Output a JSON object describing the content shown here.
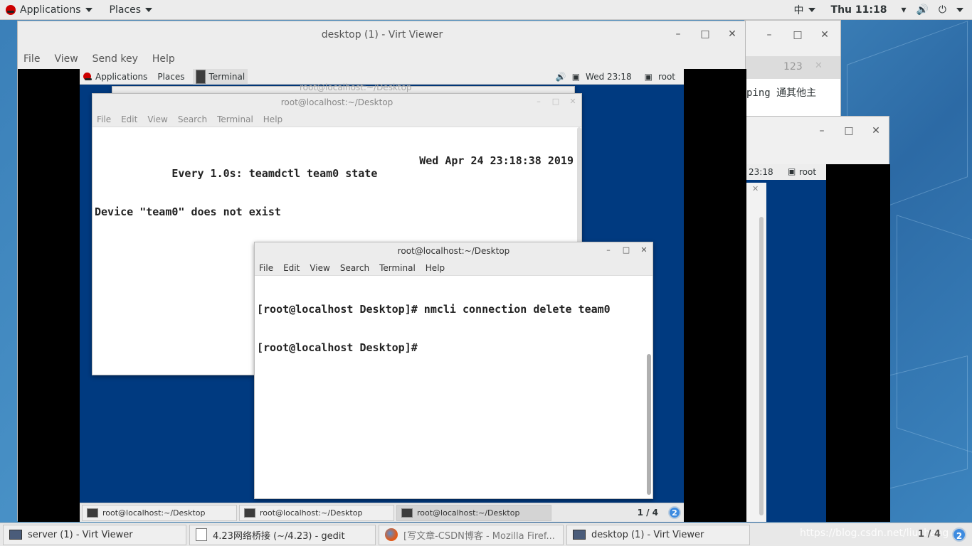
{
  "host_topbar": {
    "applications": "Applications",
    "places": "Places",
    "input_method": "中",
    "clock": "Thu 11:18"
  },
  "bg_window_1": {
    "tab_label": "123",
    "text": "ping 通其他主"
  },
  "bg_window_2": {
    "clock": "23:18",
    "user": "root"
  },
  "virt_viewer": {
    "title": "desktop (1) - Virt Viewer",
    "menu": [
      "File",
      "View",
      "Send key",
      "Help"
    ]
  },
  "guest": {
    "topbar": {
      "applications": "Applications",
      "places": "Places",
      "terminal": "Terminal",
      "clock": "Wed 23:18",
      "user": "root"
    },
    "hidden_terminal": {
      "title": "root@localhost:~/Desktop"
    },
    "back_terminal": {
      "title": "root@localhost:~/Desktop",
      "menu": [
        "File",
        "Edit",
        "View",
        "Search",
        "Terminal",
        "Help"
      ],
      "line1_left": "Every 1.0s: teamdctl team0 state",
      "line1_right": "Wed Apr 24 23:18:38 2019",
      "line2": "Device \"team0\" does not exist"
    },
    "front_terminal": {
      "title": "root@localhost:~/Desktop",
      "menu": [
        "File",
        "Edit",
        "View",
        "Search",
        "Terminal",
        "Help"
      ],
      "lines": [
        "[root@localhost Desktop]# nmcli connection delete team0",
        "[root@localhost Desktop]# "
      ]
    },
    "taskbar": {
      "tasks": [
        "root@localhost:~/Desktop",
        "root@localhost:~/Desktop",
        "root@localhost:~/Desktop"
      ],
      "workspace": "1 / 4",
      "badge": "2"
    }
  },
  "host_taskbar": {
    "tasks": [
      "server (1) - Virt Viewer",
      "4.23网络桥接 (~/4.23) - gedit",
      "[写文章-CSDN博客 - Mozilla Firef...",
      "desktop (1) - Virt Viewer"
    ],
    "workspace": "1 / 4",
    "badge": "2",
    "watermark": "https://blog.csdn.net/liuchang"
  }
}
